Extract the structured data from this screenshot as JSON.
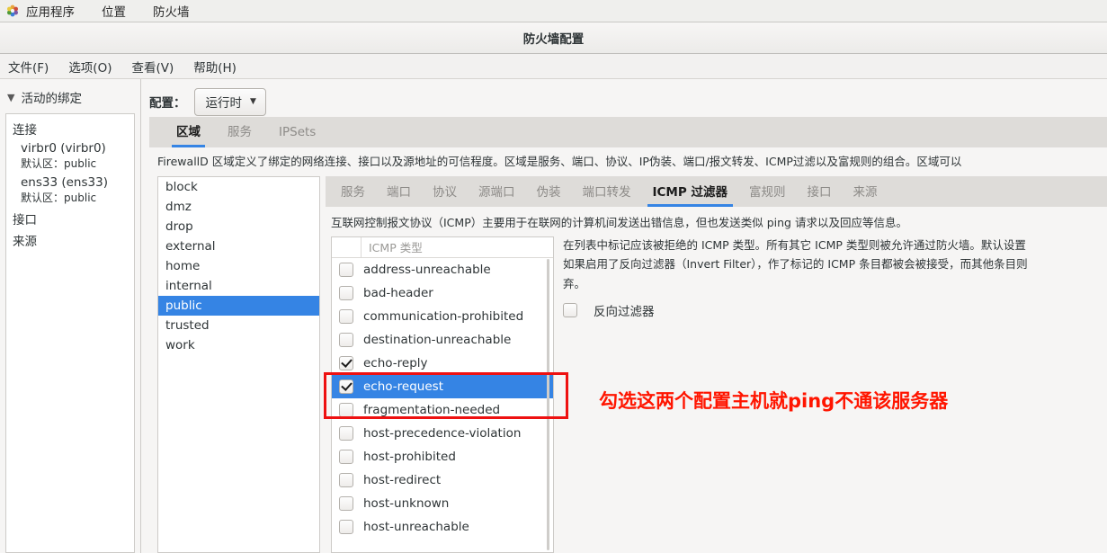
{
  "desktop": {
    "logo_icon": "gnome-pinwheel-icon",
    "menus": [
      "应用程序",
      "位置",
      "防火墙"
    ]
  },
  "window": {
    "title": "防火墙配置",
    "menubar": [
      "文件(F)",
      "选项(O)",
      "查看(V)",
      "帮助(H)"
    ]
  },
  "sidebar": {
    "header": "活动的绑定",
    "collapse_icon": "chevron-down-icon",
    "groups": [
      {
        "label": "连接",
        "connections": [
          {
            "name": "virbr0 (virbr0)",
            "zone_label": "默认区：",
            "zone": "public"
          },
          {
            "name": "ens33 (ens33)",
            "zone_label": "默认区：",
            "zone": "public"
          }
        ]
      },
      {
        "label": "接口",
        "connections": []
      },
      {
        "label": "来源",
        "connections": []
      }
    ]
  },
  "toolbar": {
    "config_label": "配置：",
    "config_value": "运行时",
    "dropdown_icon": "chevron-down-icon"
  },
  "main_tabs": {
    "items": [
      "区域",
      "服务",
      "IPSets"
    ],
    "active": "区域"
  },
  "zone_description": "FirewallD 区域定义了绑定的网络连接、接口以及源地址的可信程度。区域是服务、端口、协议、IP伪装、端口/报文转发、ICMP过滤以及富规则的组合。区域可以",
  "zones": {
    "items": [
      "block",
      "dmz",
      "drop",
      "external",
      "home",
      "internal",
      "public",
      "trusted",
      "work"
    ],
    "selected": "public"
  },
  "zone_tabs": {
    "items": [
      "服务",
      "端口",
      "协议",
      "源端口",
      "伪装",
      "端口转发",
      "ICMP 过滤器",
      "富规则",
      "接口",
      "来源"
    ],
    "active": "ICMP 过滤器"
  },
  "icmp": {
    "description": "互联网控制报文协议（ICMP）主要用于在联网的计算机间发送出错信息，但也发送类似 ping 请求以及回应等信息。",
    "list_header": "ICMP 类型",
    "help_lines": [
      "在列表中标记应该被拒绝的 ICMP 类型。所有其它 ICMP 类型则被允许通过防火墙。默认设置",
      "如果启用了反向过滤器（Invert Filter），作了标记的 ICMP 条目都被会被接受，而其他条目则",
      "弃。"
    ],
    "invert_label": "反向过滤器",
    "invert_checked": false,
    "types": [
      {
        "name": "address-unreachable",
        "checked": false,
        "selected": false
      },
      {
        "name": "bad-header",
        "checked": false,
        "selected": false
      },
      {
        "name": "communication-prohibited",
        "checked": false,
        "selected": false
      },
      {
        "name": "destination-unreachable",
        "checked": false,
        "selected": false
      },
      {
        "name": "echo-reply",
        "checked": true,
        "selected": false
      },
      {
        "name": "echo-request",
        "checked": true,
        "selected": true
      },
      {
        "name": "fragmentation-needed",
        "checked": false,
        "selected": false
      },
      {
        "name": "host-precedence-violation",
        "checked": false,
        "selected": false
      },
      {
        "name": "host-prohibited",
        "checked": false,
        "selected": false
      },
      {
        "name": "host-redirect",
        "checked": false,
        "selected": false
      },
      {
        "name": "host-unknown",
        "checked": false,
        "selected": false
      },
      {
        "name": "host-unreachable",
        "checked": false,
        "selected": false
      }
    ]
  },
  "annotation": {
    "text": "勾选这两个配置主机就ping不通该服务器",
    "color": "#ff1500",
    "highlight_color": "#ee1111"
  },
  "colors": {
    "accent": "#3584e4",
    "window_bg": "#f6f5f4",
    "tabstrip_bg": "#dedcd9"
  }
}
